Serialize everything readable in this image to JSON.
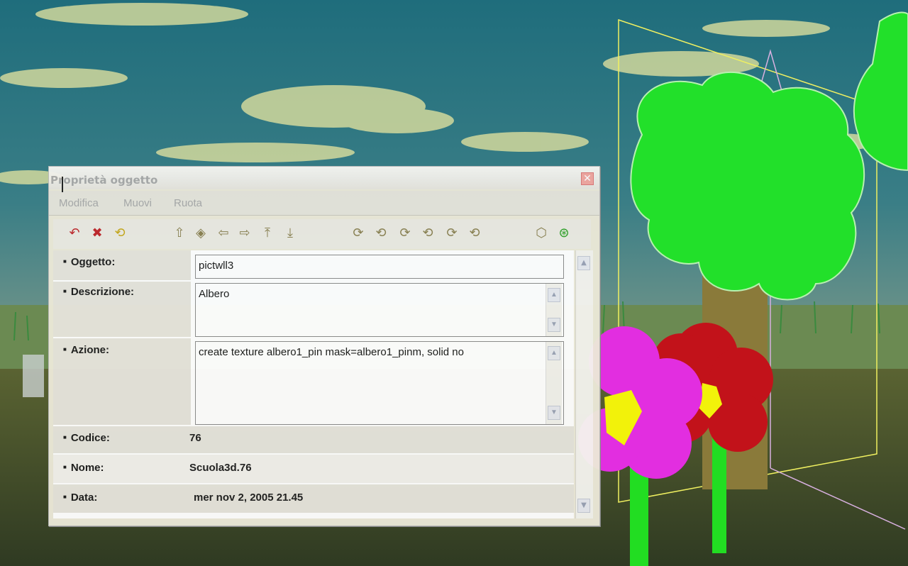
{
  "dialog": {
    "title": "Proprietà oggetto",
    "close_icon": "close-icon"
  },
  "menu": {
    "items": [
      "Modifica",
      "Muovi",
      "Ruota"
    ]
  },
  "toolbar": {
    "icons": [
      "undo-icon",
      "delete-icon",
      "refresh-icon",
      "move-up-icon",
      "rotate-icon",
      "move-left-icon",
      "move-right-icon",
      "raise-icon",
      "lower-icon",
      "rotate-x-pos-icon",
      "rotate-x-neg-icon",
      "rotate-y-pos-icon",
      "rotate-y-neg-icon",
      "rotate-z-pos-icon",
      "rotate-z-neg-icon",
      "object-icon",
      "snap-icon"
    ]
  },
  "properties": {
    "oggetto": {
      "label": "Oggetto:",
      "value": "pictwll3"
    },
    "descrizione": {
      "label": "Descrizione:",
      "value": "Albero"
    },
    "azione": {
      "label": "Azione:",
      "value": "create  texture albero1_pin mask=albero1_pinm, solid no"
    },
    "codice": {
      "label": "Codice:",
      "value": "76"
    },
    "nome": {
      "label": "Nome:",
      "value": "Scuola3d.76"
    },
    "data": {
      "label": "Data:",
      "value": "mer nov 2, 2005 21.45"
    }
  },
  "colors": {
    "sky": "#1f6f7d",
    "ground": "#3e4a2a",
    "tree_green": "#22e02a",
    "flower_magenta": "#e22ee0",
    "flower_red": "#c2121a",
    "selection_yellow": "#f2f25a"
  }
}
